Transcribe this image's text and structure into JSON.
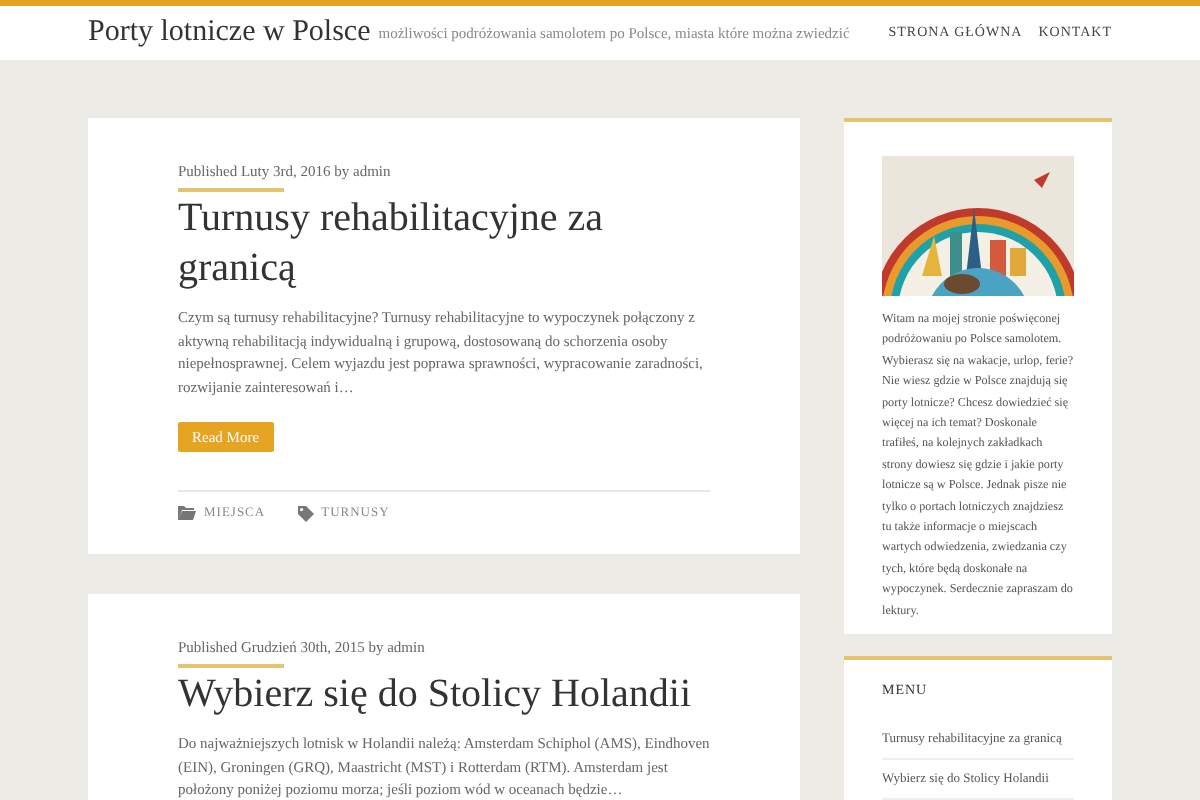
{
  "site": {
    "title": "Porty lotnicze w Polsce",
    "tagline": "możliwości podróżowania samolotem po Polsce, miasta które można zwiedzić"
  },
  "nav": [
    {
      "label": "STRONA GŁÓWNA"
    },
    {
      "label": "KONTAKT"
    }
  ],
  "posts": [
    {
      "meta": "Published Luty 3rd, 2016 by admin",
      "title": "Turnusy rehabilitacyjne za granicą",
      "excerpt": "Czym są turnusy rehabilitacyjne? Turnusy rehabilitacyjne to wypoczynek połączony z aktywną rehabilitacją indywidualną i grupową, dostosowaną do schorzenia osoby niepełnosprawnej. Celem wyjazdu jest poprawa sprawności, wypracowanie zaradności, rozwijanie zainteresowań i…",
      "button": "Read More",
      "category": "MIEJSCA",
      "tag": "TURNUSY"
    },
    {
      "meta": "Published Grudzień 30th, 2015 by admin",
      "title": "Wybierz się do Stolicy Holandii",
      "excerpt": "Do najważniejszych lotnisk w Holandii należą: Amsterdam Schiphol (AMS), Eindhoven (EIN), Groningen (GRQ), Maastricht (MST) i Rotterdam (RTM). Amsterdam jest położony poniżej poziomu morza; jeśli poziom wód w oceanach będzie…"
    }
  ],
  "sidebar": {
    "about": "Witam na mojej stronie poświęconej podróżowaniu po Polsce samolotem. Wybierasz się na wakacje, urlop, ferie? Nie wiesz gdzie w Polsce znajdują się porty lotnicze? Chcesz dowiedzieć się więcej na ich temat? Doskonale trafiłeś, na kolejnych zakładkach strony dowiesz się gdzie i jakie porty lotnicze są w Polsce. Jednak pisze nie tylko o portach lotniczych znajdziesz tu także informacje o miejscach wartych odwiedzenia, zwiedzania czy tych, które będą doskonałe na wypoczynek. Serdecznie zapraszam do lektury.",
    "menu": {
      "title": "MENU",
      "items": [
        "Turnusy rehabilitacyjne za granicą",
        "Wybierz się do Stolicy Holandii"
      ]
    }
  }
}
